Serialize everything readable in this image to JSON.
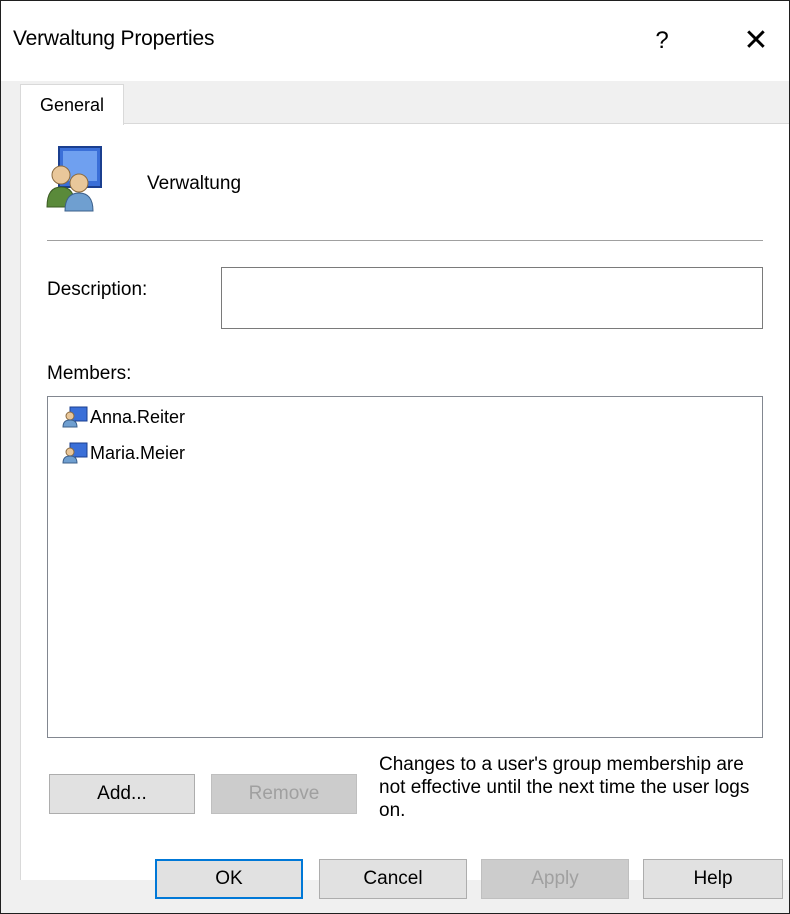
{
  "window": {
    "title": "Verwaltung Properties",
    "help_label": "?",
    "close_label": "✕"
  },
  "tabs": [
    {
      "label": "General",
      "selected": true
    }
  ],
  "group": {
    "name": "Verwaltung",
    "icon": "user-group-icon"
  },
  "description": {
    "label": "Description:",
    "value": ""
  },
  "members": {
    "label": "Members:",
    "items": [
      {
        "name": "Anna.Reiter",
        "icon": "user-icon"
      },
      {
        "name": "Maria.Meier",
        "icon": "user-icon"
      }
    ]
  },
  "member_actions": {
    "add_label": "Add...",
    "remove_label": "Remove",
    "remove_enabled": false
  },
  "note": "Changes to a user's group membership are not effective until the next time the user logs on.",
  "footer": {
    "ok_label": "OK",
    "cancel_label": "Cancel",
    "apply_label": "Apply",
    "apply_enabled": false,
    "help_label": "Help"
  },
  "colors": {
    "accent": "#0078d7",
    "window_bg": "#f0f0f0",
    "panel_bg": "#ffffff"
  }
}
